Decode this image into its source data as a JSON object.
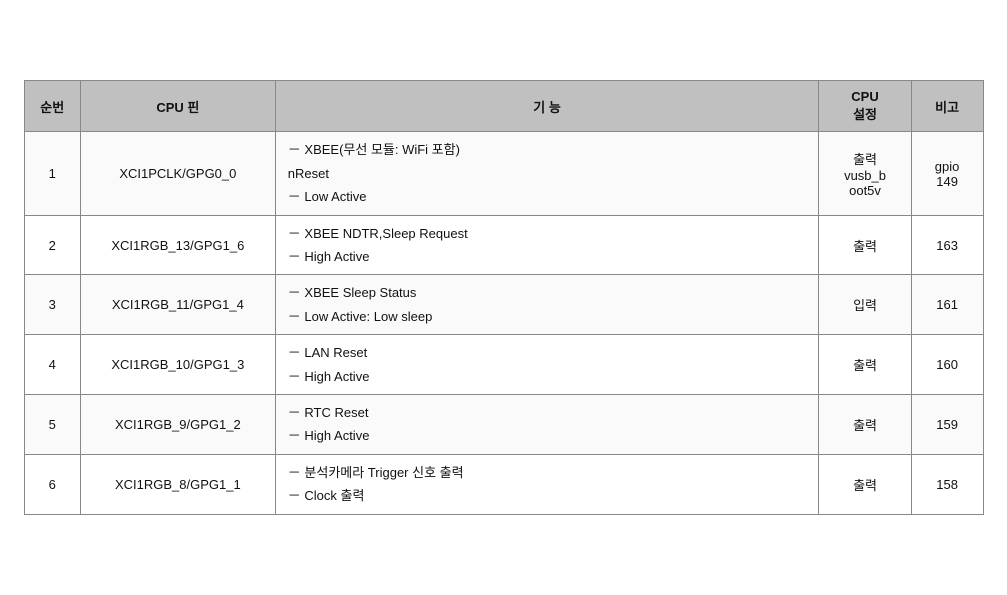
{
  "table": {
    "headers": [
      {
        "id": "seq",
        "label": "순번"
      },
      {
        "id": "pin",
        "label": "CPU 핀"
      },
      {
        "id": "func",
        "label": "기  능"
      },
      {
        "id": "cpu_setting",
        "label": "CPU\n설정"
      },
      {
        "id": "note",
        "label": "비고"
      }
    ],
    "rows": [
      {
        "seq": "1",
        "pin": "XCI1PCLK/GPG0_0",
        "functions": [
          "－ XBEE(무선 모듈: WiFi 포함)",
          "   nReset",
          "－ Low Active"
        ],
        "cpu_setting": "출력\nvusb_b\noot5v",
        "note": "gpio\n149"
      },
      {
        "seq": "2",
        "pin": "XCI1RGB_13/GPG1_6",
        "functions": [
          "－ XBEE NDTR,Sleep Request",
          "－ High Active"
        ],
        "cpu_setting": "출력",
        "note": "163"
      },
      {
        "seq": "3",
        "pin": "XCI1RGB_11/GPG1_4",
        "functions": [
          "－ XBEE Sleep Status",
          "－ Low Active: Low sleep"
        ],
        "cpu_setting": "입력",
        "note": "161"
      },
      {
        "seq": "4",
        "pin": "XCI1RGB_10/GPG1_3",
        "functions": [
          "－ LAN Reset",
          "",
          "－ High Active"
        ],
        "cpu_setting": "출력",
        "note": "160"
      },
      {
        "seq": "5",
        "pin": "XCI1RGB_9/GPG1_2",
        "functions": [
          "－ RTC Reset",
          "－ High Active"
        ],
        "cpu_setting": "출력",
        "note": "159"
      },
      {
        "seq": "6",
        "pin": "XCI1RGB_8/GPG1_1",
        "functions": [
          "－ 분석카메라 Trigger 신호 출력",
          "－ Clock 출력"
        ],
        "cpu_setting": "출력",
        "note": "158"
      }
    ]
  }
}
